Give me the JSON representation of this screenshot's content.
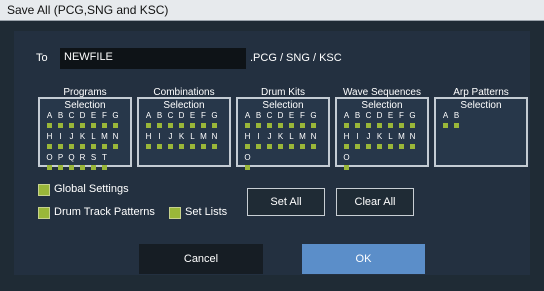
{
  "title": "Save All (PCG,SNG and KSC)",
  "to_label": "To",
  "filename": "NEWFILE",
  "extension_label": ".PCG / SNG / KSC",
  "columns": [
    {
      "title": "Programs",
      "selection_label": "Selection",
      "rows": [
        [
          "A",
          "B",
          "C",
          "D",
          "E",
          "F",
          "G"
        ],
        [
          "H",
          "I",
          "J",
          "K",
          "L",
          "M",
          "N"
        ],
        [
          "O",
          "P",
          "Q",
          "R",
          "S",
          "T"
        ]
      ]
    },
    {
      "title": "Combinations",
      "selection_label": "Selection",
      "rows": [
        [
          "A",
          "B",
          "C",
          "D",
          "E",
          "F",
          "G"
        ],
        [
          "H",
          "I",
          "J",
          "K",
          "L",
          "M",
          "N"
        ]
      ]
    },
    {
      "title": "Drum Kits",
      "selection_label": "Selection",
      "rows": [
        [
          "A",
          "B",
          "C",
          "D",
          "E",
          "F",
          "G"
        ],
        [
          "H",
          "I",
          "J",
          "K",
          "L",
          "M",
          "N"
        ],
        [
          "O"
        ]
      ]
    },
    {
      "title": "Wave Sequences",
      "selection_label": "Selection",
      "rows": [
        [
          "A",
          "B",
          "C",
          "D",
          "E",
          "F",
          "G"
        ],
        [
          "H",
          "I",
          "J",
          "K",
          "L",
          "M",
          "N"
        ],
        [
          "O"
        ]
      ]
    },
    {
      "title": "Arp Patterns",
      "selection_label": "Selection",
      "rows": [
        [
          "A",
          "B"
        ]
      ]
    }
  ],
  "options": {
    "global_settings": {
      "label": "Global Settings",
      "checked": true
    },
    "drum_track_patterns": {
      "label": "Drum Track Patterns",
      "checked": true
    },
    "set_lists": {
      "label": "Set Lists",
      "checked": true
    }
  },
  "buttons": {
    "set_all": "Set All",
    "clear_all": "Clear All",
    "cancel": "Cancel",
    "ok": "OK"
  },
  "colors": {
    "accent_green": "#9ab739",
    "ok_button": "#5b8ec9",
    "background": "#1f2b35"
  }
}
